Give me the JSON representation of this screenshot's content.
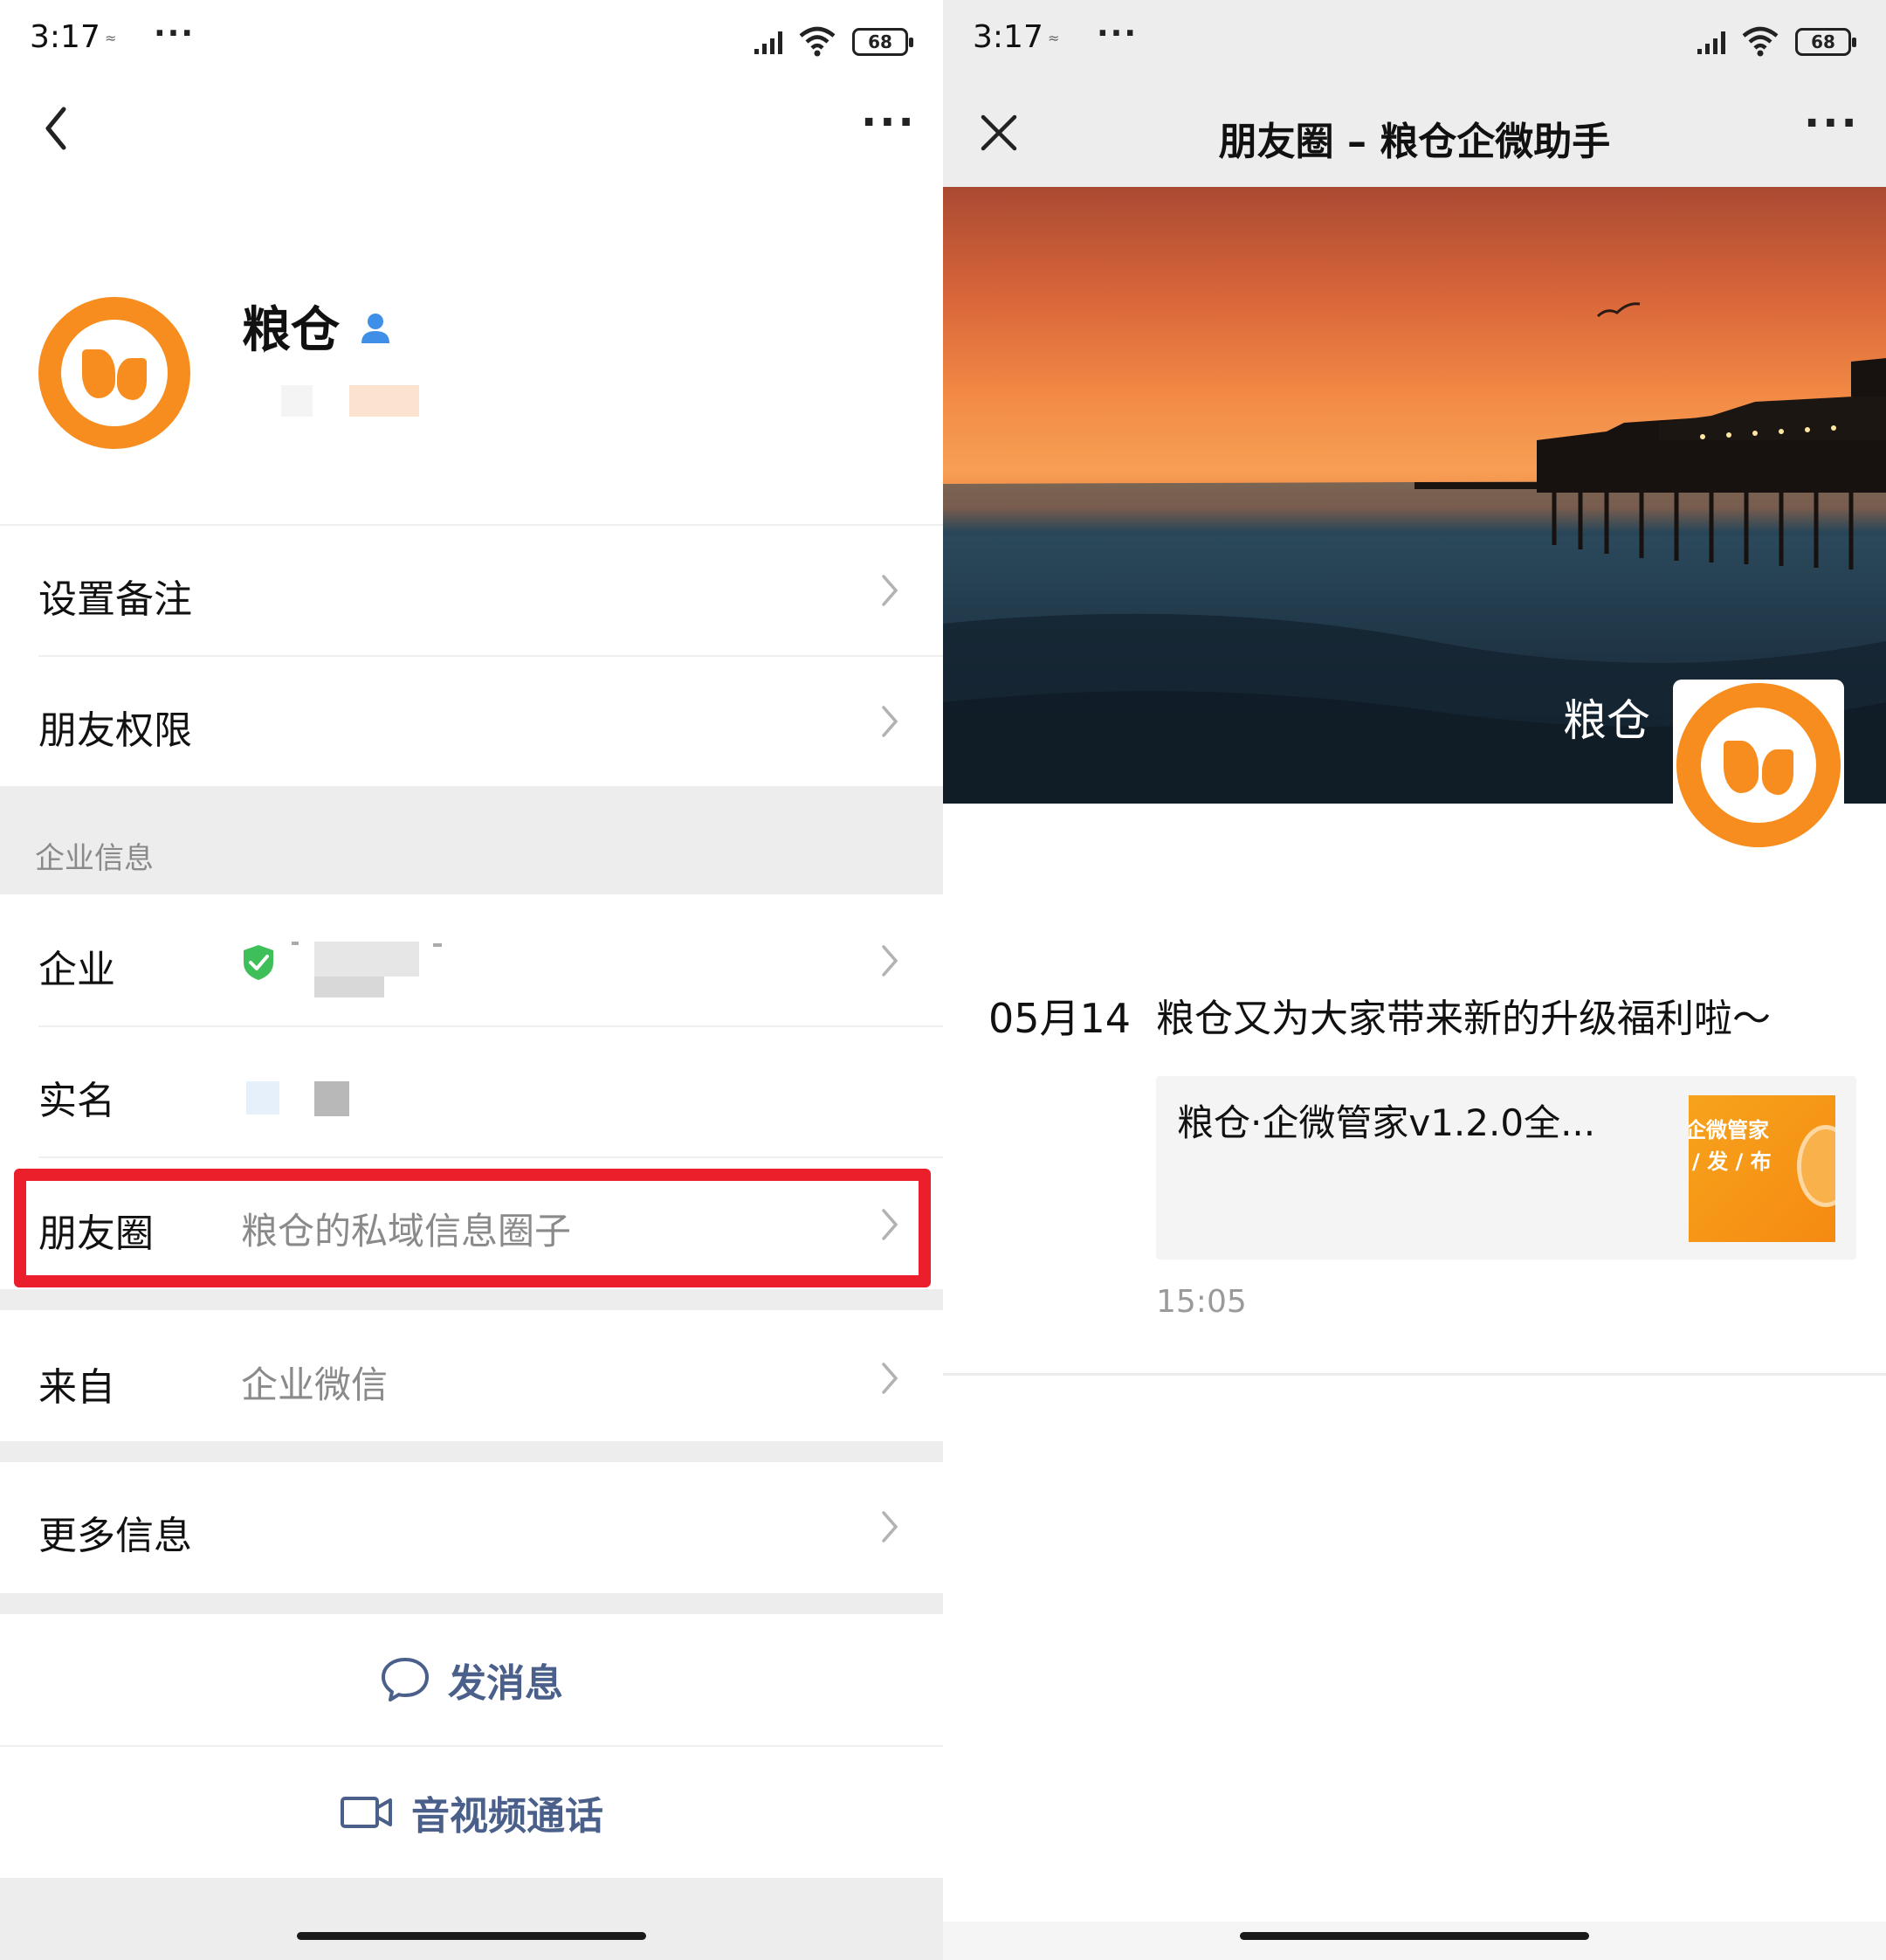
{
  "left": {
    "status": {
      "time": "3:17",
      "small": "≈",
      "dots": "···",
      "battery": "68"
    },
    "nav": {
      "back": "back",
      "more": "···"
    },
    "profile": {
      "name": "粮仓"
    },
    "rows": {
      "remark": "设置备注",
      "permissions": "朋友权限",
      "section_enterprise": "企业信息",
      "company_label": "企业",
      "realname_label": "实名",
      "moments_label": "朋友圈",
      "moments_value": "粮仓的私域信息圈子",
      "from_label": "来自",
      "from_value": "企业微信",
      "more_info": "更多信息"
    },
    "actions": {
      "message": "发消息",
      "video_call": "音视频通话"
    }
  },
  "right": {
    "status": {
      "time": "3:17",
      "small": "≈",
      "dots": "···",
      "battery": "68"
    },
    "nav": {
      "title": "朋友圈 – 粮仓企微助手",
      "more": "···"
    },
    "cover": {
      "name": "粮仓"
    },
    "post": {
      "date": "05月14",
      "text": "粮仓又为大家带来新的升级福利啦～",
      "link_title": "粮仓·企微管家v1.2.0全...",
      "thumb_line1": "企微管家",
      "thumb_line2": "/ 发 / 布",
      "time": "15:05"
    }
  },
  "colors": {
    "brand_orange": "#f78d1e",
    "highlight_red": "#ea1f2b",
    "link_blue": "#4a5f8a",
    "verify_green": "#3fbf5a"
  }
}
